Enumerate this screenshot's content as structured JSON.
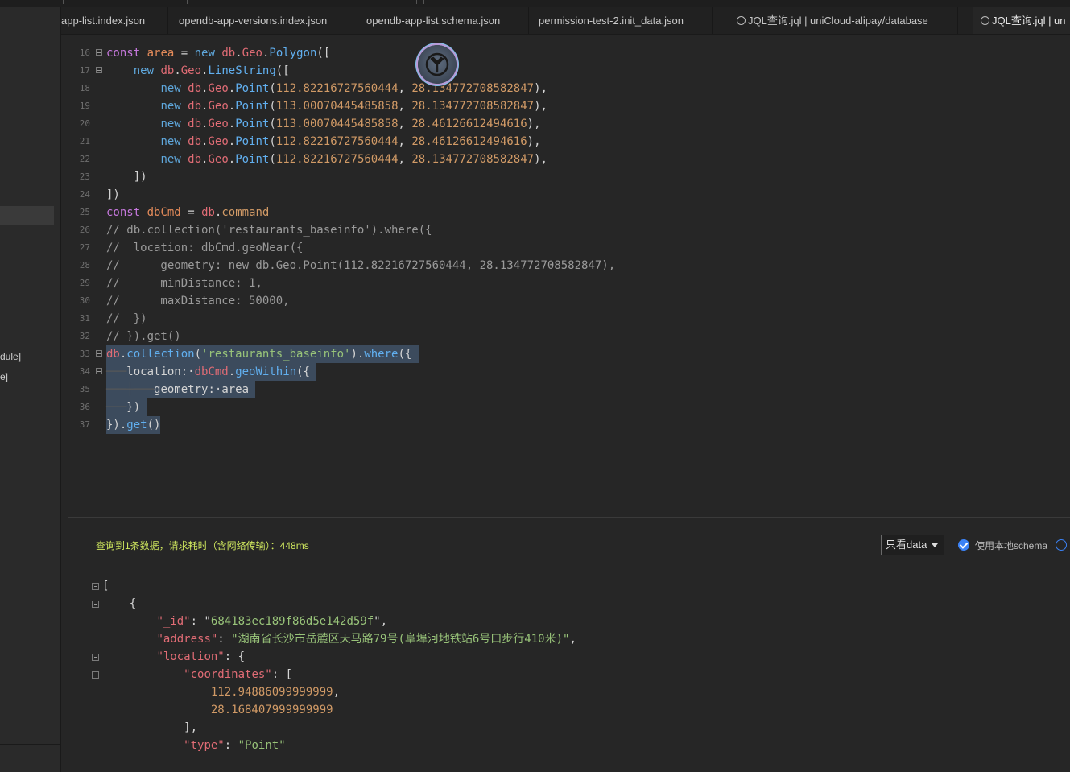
{
  "tabs": [
    {
      "label": "app-list.index.json"
    },
    {
      "label": "opendb-app-versions.index.json"
    },
    {
      "label": "opendb-app-list.schema.json"
    },
    {
      "label": "permission-test-2.init_data.json"
    },
    {
      "label": "JQL查询.jql | uniCloud-alipay/database"
    },
    {
      "label": "JQL查询.jql | un"
    }
  ],
  "sidebar": {
    "fragments": [
      "dule]",
      "e]"
    ]
  },
  "editor": {
    "line_numbers": [
      "16",
      "17",
      "18",
      "19",
      "20",
      "21",
      "22",
      "23",
      "24",
      "25",
      "26",
      "27",
      "28",
      "29",
      "30",
      "31",
      "32",
      "33",
      "34",
      "35",
      "36",
      "37"
    ],
    "points": [
      [
        "112.82216727560444",
        "28.134772708582847"
      ],
      [
        "113.00070445485858",
        "28.134772708582847"
      ],
      [
        "113.00070445485858",
        "28.46126612494616"
      ],
      [
        "112.82216727560444",
        "28.46126612494616"
      ],
      [
        "112.82216727560444",
        "28.134772708582847"
      ]
    ],
    "collection_name": "'restaurants_baseinfo'",
    "comments": [
      "// db.collection('restaurants_baseinfo').where({",
      "//  location: dbCmd.geoNear({",
      "//      geometry: new db.Geo.Point(112.82216727560444, 28.134772708582847),",
      "//      minDistance: 1,",
      "//      maxDistance: 50000,",
      "//  })",
      "// }).get()"
    ]
  },
  "result_panel": {
    "status": "查询到1条数据，请求耗时（含网络传输）：448ms",
    "view_select": "只看data",
    "use_local_schema_label": "使用本地schema",
    "use_local_schema_checked": true
  },
  "result_json": {
    "_id": "684183ec189f86d5e142d59f",
    "address": "湖南省长沙市岳麓区天马路79号(阜埠河地铁站6号口步行410米)",
    "coordinates": [
      "112.94886099999999",
      "28.168407999999999"
    ],
    "type": "Point"
  },
  "colors": {
    "accent": "#3b82f6",
    "status_text": "#cfe75e",
    "selection": "#3c4b5d"
  },
  "icons": [
    "jql-file-icon",
    "unicloud-floating-logo-icon",
    "chevron-down-icon",
    "check-icon"
  ]
}
